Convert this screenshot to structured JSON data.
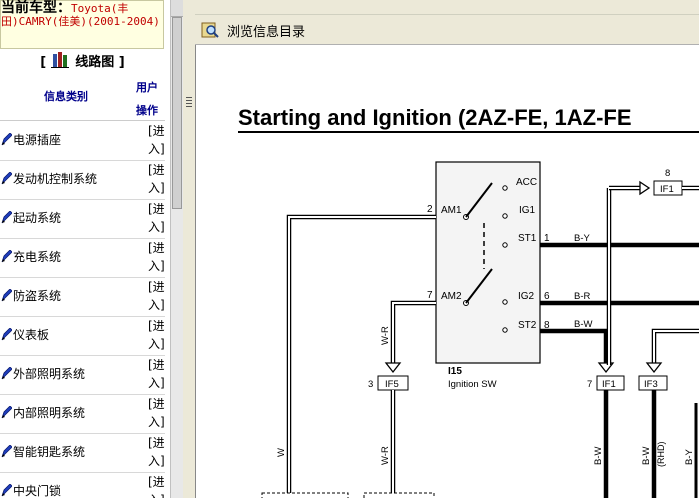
{
  "left": {
    "current_model_label": "当前车型：",
    "current_model_value": "Toyota(丰田)CAMRY(佳美)(2001-2004)",
    "diagram_title": "线路图",
    "diagram_bracket_open": "[",
    "diagram_bracket_close": "]",
    "col_category": "信息类别",
    "col_action_1": "用户",
    "col_action_2": "操作",
    "action_line1": "[进",
    "action_line2": "入]",
    "rows": [
      {
        "label": "电源插座"
      },
      {
        "label": "发动机控制系统"
      },
      {
        "label": "起动系统"
      },
      {
        "label": "充电系统"
      },
      {
        "label": "防盗系统"
      },
      {
        "label": "仪表板"
      },
      {
        "label": "外部照明系统"
      },
      {
        "label": "内部照明系统"
      },
      {
        "label": "智能钥匙系统"
      },
      {
        "label": "中央门锁"
      }
    ]
  },
  "toolbar": {
    "browse_label": "浏览信息目录"
  },
  "diagram": {
    "title": "Starting and Ignition (2AZ-FE, 1AZ-FE",
    "switch_id": "I15",
    "switch_name": "Ignition SW",
    "terminals": {
      "am1": "AM1",
      "am2": "AM2",
      "acc": "ACC",
      "ig1": "IG1",
      "st1": "ST1",
      "ig2": "IG2",
      "st2": "ST2"
    },
    "pins": {
      "am1": "2",
      "am2": "7",
      "st1": "1",
      "ig2": "6",
      "st2": "8"
    },
    "wires": {
      "st1": "B-Y",
      "ig2": "B-R",
      "st2": "B-W",
      "am2": "W-R",
      "am2_lower": "W-R",
      "am1_lower": "W",
      "if1_lower": "B-W",
      "if3_lower_a": "B-W",
      "if3_lower_b": "(RHD)",
      "if3_lower_c": "B-Y"
    },
    "connectors": {
      "if5": "IF5",
      "if5_pin": "3",
      "if1": "IF1",
      "if1_pin": "7",
      "if3": "IF3",
      "if1_top": "IF1",
      "if1_top_pin": "8"
    }
  }
}
